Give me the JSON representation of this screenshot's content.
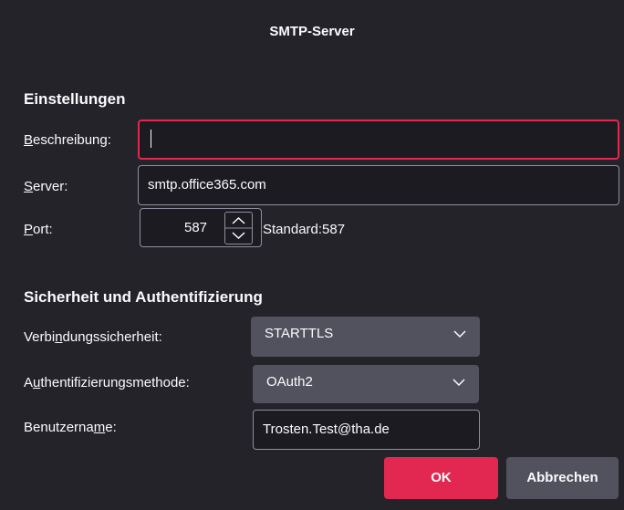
{
  "dialog": {
    "title": "SMTP-Server",
    "settings_heading": "Einstellungen",
    "description": {
      "label_access_key": "B",
      "label_rest": "eschreibung:",
      "value": ""
    },
    "server": {
      "label_access_key": "S",
      "label_rest": "erver:",
      "value": "smtp.office365.com"
    },
    "port": {
      "label_access_key": "P",
      "label_rest": "ort:",
      "value": "587",
      "default_text": "Standard:587"
    },
    "security_heading": "Sicherheit und Authentifizierung",
    "connection_security": {
      "label_before": "Verbi",
      "label_access_key": "n",
      "label_after": "dungssicherheit:",
      "selected": "STARTTLS"
    },
    "auth_method": {
      "label_before": "A",
      "label_access_key": "u",
      "label_after": "thentifizierungsmethode:",
      "selected": "OAuth2"
    },
    "username": {
      "label_before": "Benutzerna",
      "label_access_key": "m",
      "label_after": "e:",
      "value": "Trosten.Test@tha.de"
    },
    "buttons": {
      "ok": "OK",
      "cancel": "Abbrechen"
    }
  },
  "colors": {
    "background": "#232329",
    "accent": "#e22850",
    "select_bg": "#52525e",
    "field_bg": "#1c1b22"
  }
}
